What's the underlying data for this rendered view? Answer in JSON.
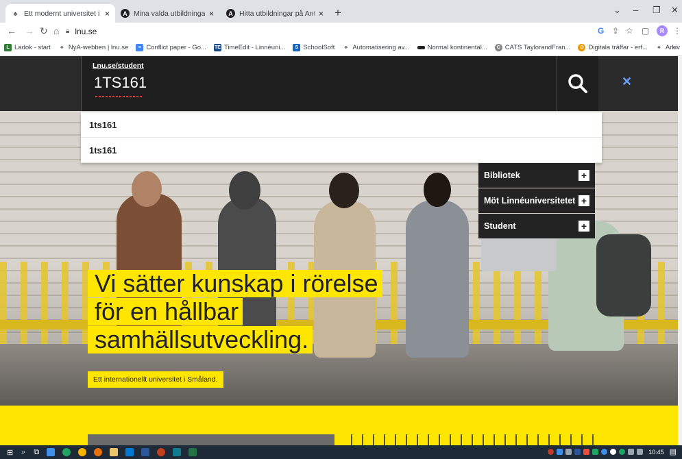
{
  "browser": {
    "tabs": [
      {
        "title": "Ett modernt universitet i Smålan",
        "active": true
      },
      {
        "title": "Mina valda utbildningar - Antagn",
        "active": false
      },
      {
        "title": "Hitta utbildningar på Antagning.",
        "active": false
      }
    ],
    "url": "lnu.se",
    "bookmarks": [
      {
        "label": "Ladok - start",
        "color": "#2e7d32"
      },
      {
        "label": "NyA-webben | lnu.se",
        "color": "#666666"
      },
      {
        "label": "Conflict paper - Go...",
        "color": "#4285f4"
      },
      {
        "label": "TimeEdit - Linnéuni...",
        "color": "#1a4a8a"
      },
      {
        "label": "SchoolSoft",
        "color": "#1565c0"
      },
      {
        "label": "Automatisering av...",
        "color": "#666666"
      },
      {
        "label": "Normal kontinental...",
        "color": "#222222"
      },
      {
        "label": "CATS TaylorandFran...",
        "color": "#555555"
      },
      {
        "label": "Digitala träffar - erf...",
        "color": "#f29900"
      },
      {
        "label": "Arkiv för kurs- och...",
        "color": "#666666"
      }
    ],
    "profile_initial": "R"
  },
  "search": {
    "label": "Lnu.se/student",
    "value": "1TS161",
    "suggestions": [
      "1ts161",
      "1ts161"
    ]
  },
  "sidenav": {
    "items": [
      "Bibliotek",
      "Möt Linnéuniversitetet",
      "Student"
    ]
  },
  "hero": {
    "headline_lines": [
      "Vi sätter kunskap i rörelse",
      "för en hållbar",
      "samhällsutveckling."
    ],
    "subline": "Ett internationellt universitet i Småland."
  },
  "taskbar": {
    "time": "10:45"
  },
  "colors": {
    "accent": "#ffe600",
    "dark": "#1e1e1e",
    "clear_icon": "#6ea0ff"
  }
}
